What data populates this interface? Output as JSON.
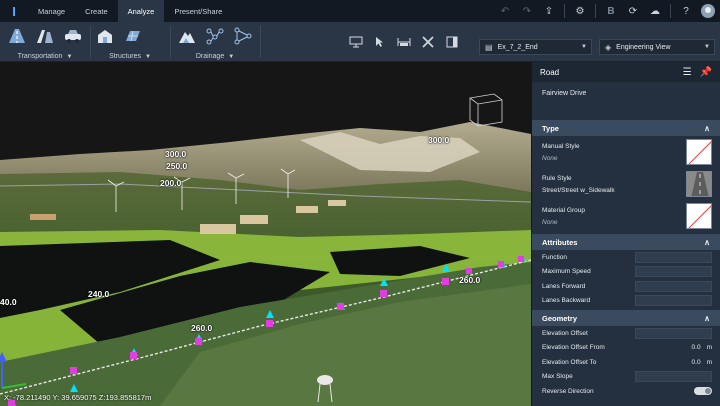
{
  "topbar": {
    "tabs": [
      {
        "label": "Manage"
      },
      {
        "label": "Create"
      },
      {
        "label": "Analyze"
      },
      {
        "label": "Present/Share"
      }
    ],
    "active_tab": "Analyze",
    "icons": [
      "undo-icon",
      "redo-icon",
      "share-icon",
      "settings-icon",
      "b-icon",
      "refresh-icon",
      "cloud-icon",
      "help-icon",
      "user-icon"
    ]
  },
  "ribbon": {
    "groups": [
      {
        "label": "Transportation"
      },
      {
        "label": "Structures"
      },
      {
        "label": "Drainage"
      }
    ],
    "scenario_dropdown": {
      "value": "Ex_7_2_End"
    },
    "view_dropdown": {
      "value": "Engineering View"
    }
  },
  "viewport": {
    "elevation_labels": [
      "300.0",
      "250.0",
      "200.0",
      "300.0",
      "240.0",
      "260.0",
      "260.0",
      "40.0"
    ],
    "coords": "X: -78.211490 Y: 39.659075 Z:193.855817m"
  },
  "panel": {
    "title": "Road",
    "subtitle": "Fairview Drive",
    "sections": {
      "type": {
        "title": "Type",
        "manual_style_label": "Manual Style",
        "manual_style_value": "None",
        "rule_style_label": "Rule Style",
        "rule_style_value": "Street/Street w_Sidewalk",
        "material_group_label": "Material Group",
        "material_group_value": "None"
      },
      "attributes": {
        "title": "Attributes",
        "rows": [
          {
            "label": "Function",
            "value": ""
          },
          {
            "label": "Maximum Speed",
            "value": ""
          },
          {
            "label": "Lanes Forward",
            "value": ""
          },
          {
            "label": "Lanes Backward",
            "value": ""
          }
        ]
      },
      "geometry": {
        "title": "Geometry",
        "rows": [
          {
            "label": "Elevation Offset",
            "value": "",
            "unit": ""
          },
          {
            "label": "Elevation Offset From",
            "value": "0.0",
            "unit": "m"
          },
          {
            "label": "Elevation Offset To",
            "value": "0.0",
            "unit": "m"
          },
          {
            "label": "Max Slope",
            "value": "",
            "unit": ""
          },
          {
            "label": "Reverse Direction",
            "value": "",
            "unit": ""
          }
        ]
      }
    }
  },
  "colors": {
    "accent": "#5aa8ff",
    "panel_bg": "#243040",
    "section_header": "#3a4b60",
    "ribbon_bg": "#2a3646"
  }
}
